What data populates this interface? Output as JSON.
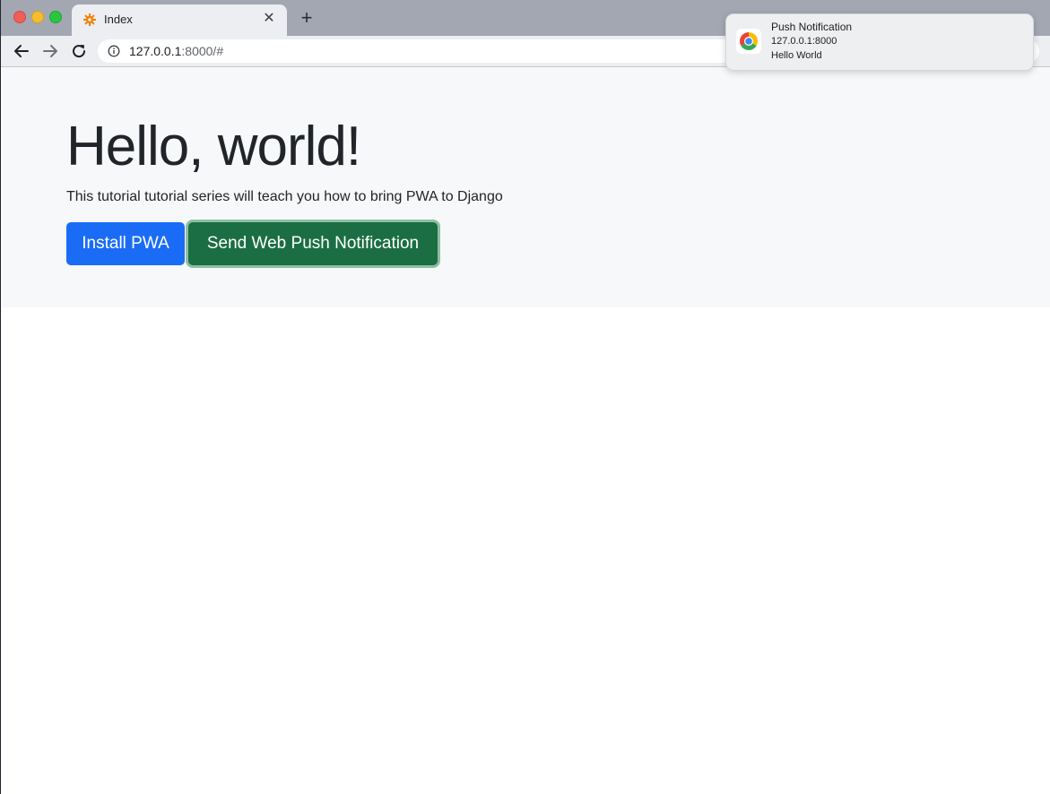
{
  "browser": {
    "tab": {
      "title": "Index",
      "favicon": "gear-favicon-icon",
      "close_glyph": "✕"
    },
    "new_tab_glyph": "+",
    "address_bar": {
      "host": "127.0.0.1",
      "rest": ":8000/#"
    }
  },
  "page": {
    "heading": "Hello, world!",
    "lead": "This tutorial tutorial series will teach you how to bring PWA to Django",
    "buttons": {
      "install": "Install PWA",
      "push": "Send Web Push Notification"
    }
  },
  "notification": {
    "icon": "chrome-icon",
    "title": "Push Notification",
    "subtitle": "127.0.0.1:8000",
    "body": "Hello World"
  },
  "colors": {
    "primary": "#1a6cf6",
    "success": "#1b6e43",
    "jumbotron_bg": "#f7f8f9"
  }
}
